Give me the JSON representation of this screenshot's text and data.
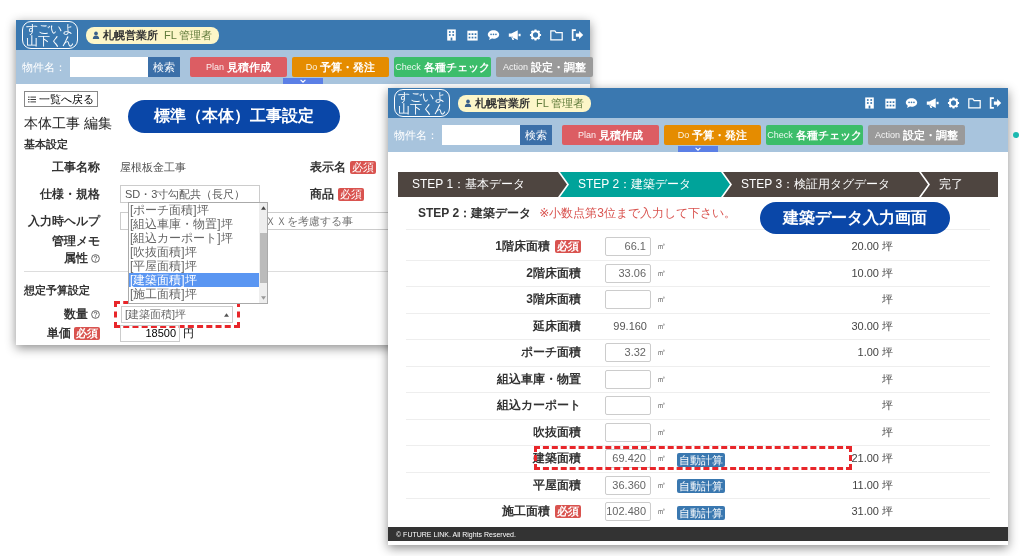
{
  "back_window": {
    "header": {
      "logo_top": "すごいよ",
      "logo_bottom": "山下くん",
      "office": "札幌営業所",
      "role": "FL 管理者"
    },
    "search": {
      "label": "物件名：",
      "button": "検索"
    },
    "nav_buttons": [
      {
        "label": "Plan",
        "sub": "見積作成",
        "color": "#dc5d63"
      },
      {
        "label": "Do",
        "sub": "予算・発注",
        "color": "#e58c00"
      },
      {
        "label": "Check",
        "sub": "各種チェック",
        "color": "#3cbd6a"
      },
      {
        "label": "Action",
        "sub": "設定・調整",
        "color": "#9a9a9a"
      }
    ],
    "back_button": "一覧へ戻る",
    "page_title": "本体工事 編集",
    "callout": "標準（本体）工事設定",
    "basic_title": "基本設定",
    "work_name": {
      "label": "工事名称",
      "value": "屋根板金工事"
    },
    "display_name": {
      "label": "表示名",
      "badge": "必須"
    },
    "spec": {
      "label": "仕様・規格",
      "value": "SD・3寸勾配共（長尺）"
    },
    "product": {
      "label": "商品",
      "badge": "必須"
    },
    "input_help": {
      "label": "入力時ヘルプ",
      "placeholder": "ＸＸを考慮する事"
    },
    "memo": {
      "label": "管理メモ"
    },
    "attribute": {
      "label": "属性"
    },
    "budget_title": "想定予算設定",
    "quantity": {
      "label": "数量",
      "value": "[建築面積]坪",
      "highlighted": true,
      "expanded": true,
      "options": [
        {
          "label": "[ポーチ面積]坪",
          "selected": false
        },
        {
          "label": "[組込車庫・物置]坪",
          "selected": false
        },
        {
          "label": "[組込カーポート]坪",
          "selected": false
        },
        {
          "label": "[吹抜面積]坪",
          "selected": false
        },
        {
          "label": "[平屋面積]坪",
          "selected": false
        },
        {
          "label": "[建築面積]坪",
          "selected": true
        },
        {
          "label": "[施工面積]坪",
          "selected": false
        }
      ]
    },
    "unit_price": {
      "label": "単価",
      "badge": "必須",
      "value": "18500",
      "unit": "円"
    }
  },
  "front_window": {
    "header": {
      "logo_top": "すごいよ",
      "logo_bottom": "山下くん",
      "office": "札幌営業所",
      "role": "FL 管理者"
    },
    "search": {
      "label": "物件名：",
      "button": "検索"
    },
    "nav_buttons": [
      {
        "label": "Plan",
        "sub": "見積作成",
        "color": "#dc5d63"
      },
      {
        "label": "Do",
        "sub": "予算・発注",
        "color": "#e58c00"
      },
      {
        "label": "Check",
        "sub": "各種チェック",
        "color": "#3cbd6a"
      },
      {
        "label": "Action",
        "sub": "設定・調整",
        "color": "#9a9a9a"
      }
    ],
    "steps": [
      {
        "label": "STEP 1：基本データ",
        "selected": false
      },
      {
        "label": "STEP 2：建築データ",
        "selected": true
      },
      {
        "label": "STEP 3：検証用タグデータ",
        "selected": false
      },
      {
        "label": "完了",
        "selected": false
      }
    ],
    "section_title": "STEP 2：建築データ",
    "note": "※小数点第3位まで入力して下さい。",
    "callout": "建築データ入力画面",
    "rows": [
      {
        "label": "1階床面積",
        "badge": "必須",
        "kind": "input",
        "value": "66.1",
        "unit": "㎡",
        "tsubo": "20.00 坪",
        "highlighted": false
      },
      {
        "label": "2階床面積",
        "kind": "input",
        "value": "33.06",
        "unit": "㎡",
        "tsubo": "10.00 坪",
        "highlighted": false
      },
      {
        "label": "3階床面積",
        "kind": "input",
        "unit": "㎡",
        "tsubo": "坪",
        "highlighted": false
      },
      {
        "label": "延床面積",
        "kind": "text",
        "value": "99.160",
        "unit": "㎡",
        "tsubo": "30.00 坪",
        "highlighted": false
      },
      {
        "label": "ポーチ面積",
        "kind": "input",
        "value": "3.32",
        "unit": "㎡",
        "tsubo": "1.00 坪",
        "highlighted": false
      },
      {
        "label": "組込車庫・物置",
        "kind": "input",
        "unit": "㎡",
        "tsubo": "坪",
        "highlighted": false
      },
      {
        "label": "組込カーポート",
        "kind": "input",
        "unit": "㎡",
        "tsubo": "坪",
        "highlighted": false
      },
      {
        "label": "吹抜面積",
        "kind": "input",
        "unit": "㎡",
        "tsubo": "坪",
        "highlighted": false
      },
      {
        "label": "建築面積",
        "kind": "input",
        "value": "69.420",
        "unit": "㎡",
        "auto": "自動計算",
        "tsubo": "21.00 坪",
        "highlighted": true
      },
      {
        "label": "平屋面積",
        "kind": "input",
        "value": "36.360",
        "unit": "㎡",
        "auto": "自動計算",
        "tsubo": "11.00 坪",
        "highlighted": false
      },
      {
        "label": "施工面積",
        "badge": "必須",
        "kind": "input",
        "value": "102.480",
        "unit": "㎡",
        "auto": "自動計算",
        "tsubo": "31.00 坪",
        "highlighted": false
      }
    ],
    "footer": "© FUTURE LINK. All Rights Reserved."
  }
}
